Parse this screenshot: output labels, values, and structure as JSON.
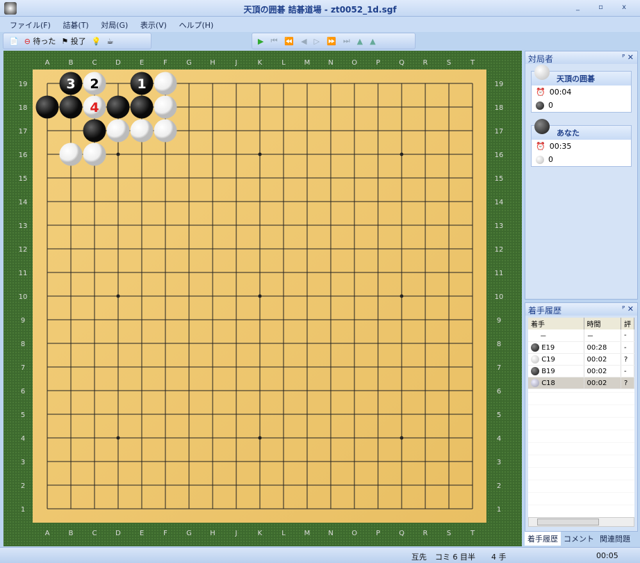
{
  "window": {
    "title": "天頂の囲碁 詰碁道場 - zt0052_1d.sgf"
  },
  "menu": [
    "ファイル(F)",
    "詰碁(T)",
    "対局(G)",
    "表示(V)",
    "ヘルプ(H)"
  ],
  "toolbar": {
    "undo_label": "待った",
    "resign_label": "投了"
  },
  "board": {
    "columns": [
      "A",
      "B",
      "C",
      "D",
      "E",
      "F",
      "G",
      "H",
      "J",
      "K",
      "L",
      "M",
      "N",
      "O",
      "P",
      "Q",
      "R",
      "S",
      "T"
    ],
    "size": 19,
    "stones": [
      {
        "color": "black",
        "point": "B19",
        "label": "3"
      },
      {
        "color": "white",
        "point": "C19",
        "label": "2"
      },
      {
        "color": "black",
        "point": "E19",
        "label": "1"
      },
      {
        "color": "white",
        "point": "F19"
      },
      {
        "color": "black",
        "point": "A18"
      },
      {
        "color": "black",
        "point": "B18"
      },
      {
        "color": "white",
        "point": "C18",
        "label": "4",
        "label_color": "#e02020"
      },
      {
        "color": "black",
        "point": "D18"
      },
      {
        "color": "black",
        "point": "E18"
      },
      {
        "color": "white",
        "point": "F18"
      },
      {
        "color": "black",
        "point": "C17"
      },
      {
        "color": "white",
        "point": "D17"
      },
      {
        "color": "white",
        "point": "E17"
      },
      {
        "color": "white",
        "point": "F17"
      },
      {
        "color": "white",
        "point": "B16"
      },
      {
        "color": "white",
        "point": "C16"
      }
    ]
  },
  "players_panel": {
    "title": "対局者",
    "players": [
      {
        "name": "天頂の囲碁",
        "stone": "white",
        "time": "00:04",
        "captures": "0"
      },
      {
        "name": "あなた",
        "stone": "black",
        "time": "00:35",
        "captures": "0"
      }
    ]
  },
  "history_panel": {
    "title": "着手履歴",
    "headers": [
      "着手",
      "時間",
      "評"
    ],
    "rows": [
      {
        "stone": "",
        "move": "－",
        "time": "－",
        "eval": "-"
      },
      {
        "stone": "black",
        "move": "E19",
        "time": "00:28",
        "eval": "-"
      },
      {
        "stone": "white",
        "move": "C19",
        "time": "00:02",
        "eval": "?"
      },
      {
        "stone": "black",
        "move": "B19",
        "time": "00:02",
        "eval": "-"
      },
      {
        "stone": "last",
        "move": "C18",
        "time": "00:02",
        "eval": "?"
      }
    ]
  },
  "bottom_tabs": [
    "着手履歴",
    "コメント",
    "関連問題"
  ],
  "status": {
    "handicap": "互先",
    "komi": "コミ 6 目半",
    "moves": "4 手",
    "clock": "00:05"
  }
}
